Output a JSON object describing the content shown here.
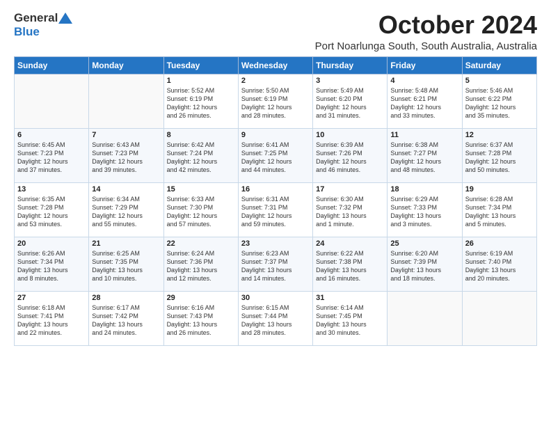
{
  "logo": {
    "general": "General",
    "blue": "Blue"
  },
  "title": "October 2024",
  "location": "Port Noarlunga South, South Australia, Australia",
  "days_of_week": [
    "Sunday",
    "Monday",
    "Tuesday",
    "Wednesday",
    "Thursday",
    "Friday",
    "Saturday"
  ],
  "weeks": [
    [
      {
        "day": "",
        "info": ""
      },
      {
        "day": "",
        "info": ""
      },
      {
        "day": "1",
        "info": "Sunrise: 5:52 AM\nSunset: 6:19 PM\nDaylight: 12 hours\nand 26 minutes."
      },
      {
        "day": "2",
        "info": "Sunrise: 5:50 AM\nSunset: 6:19 PM\nDaylight: 12 hours\nand 28 minutes."
      },
      {
        "day": "3",
        "info": "Sunrise: 5:49 AM\nSunset: 6:20 PM\nDaylight: 12 hours\nand 31 minutes."
      },
      {
        "day": "4",
        "info": "Sunrise: 5:48 AM\nSunset: 6:21 PM\nDaylight: 12 hours\nand 33 minutes."
      },
      {
        "day": "5",
        "info": "Sunrise: 5:46 AM\nSunset: 6:22 PM\nDaylight: 12 hours\nand 35 minutes."
      }
    ],
    [
      {
        "day": "6",
        "info": "Sunrise: 6:45 AM\nSunset: 7:23 PM\nDaylight: 12 hours\nand 37 minutes."
      },
      {
        "day": "7",
        "info": "Sunrise: 6:43 AM\nSunset: 7:23 PM\nDaylight: 12 hours\nand 39 minutes."
      },
      {
        "day": "8",
        "info": "Sunrise: 6:42 AM\nSunset: 7:24 PM\nDaylight: 12 hours\nand 42 minutes."
      },
      {
        "day": "9",
        "info": "Sunrise: 6:41 AM\nSunset: 7:25 PM\nDaylight: 12 hours\nand 44 minutes."
      },
      {
        "day": "10",
        "info": "Sunrise: 6:39 AM\nSunset: 7:26 PM\nDaylight: 12 hours\nand 46 minutes."
      },
      {
        "day": "11",
        "info": "Sunrise: 6:38 AM\nSunset: 7:27 PM\nDaylight: 12 hours\nand 48 minutes."
      },
      {
        "day": "12",
        "info": "Sunrise: 6:37 AM\nSunset: 7:28 PM\nDaylight: 12 hours\nand 50 minutes."
      }
    ],
    [
      {
        "day": "13",
        "info": "Sunrise: 6:35 AM\nSunset: 7:28 PM\nDaylight: 12 hours\nand 53 minutes."
      },
      {
        "day": "14",
        "info": "Sunrise: 6:34 AM\nSunset: 7:29 PM\nDaylight: 12 hours\nand 55 minutes."
      },
      {
        "day": "15",
        "info": "Sunrise: 6:33 AM\nSunset: 7:30 PM\nDaylight: 12 hours\nand 57 minutes."
      },
      {
        "day": "16",
        "info": "Sunrise: 6:31 AM\nSunset: 7:31 PM\nDaylight: 12 hours\nand 59 minutes."
      },
      {
        "day": "17",
        "info": "Sunrise: 6:30 AM\nSunset: 7:32 PM\nDaylight: 13 hours\nand 1 minute."
      },
      {
        "day": "18",
        "info": "Sunrise: 6:29 AM\nSunset: 7:33 PM\nDaylight: 13 hours\nand 3 minutes."
      },
      {
        "day": "19",
        "info": "Sunrise: 6:28 AM\nSunset: 7:34 PM\nDaylight: 13 hours\nand 5 minutes."
      }
    ],
    [
      {
        "day": "20",
        "info": "Sunrise: 6:26 AM\nSunset: 7:34 PM\nDaylight: 13 hours\nand 8 minutes."
      },
      {
        "day": "21",
        "info": "Sunrise: 6:25 AM\nSunset: 7:35 PM\nDaylight: 13 hours\nand 10 minutes."
      },
      {
        "day": "22",
        "info": "Sunrise: 6:24 AM\nSunset: 7:36 PM\nDaylight: 13 hours\nand 12 minutes."
      },
      {
        "day": "23",
        "info": "Sunrise: 6:23 AM\nSunset: 7:37 PM\nDaylight: 13 hours\nand 14 minutes."
      },
      {
        "day": "24",
        "info": "Sunrise: 6:22 AM\nSunset: 7:38 PM\nDaylight: 13 hours\nand 16 minutes."
      },
      {
        "day": "25",
        "info": "Sunrise: 6:20 AM\nSunset: 7:39 PM\nDaylight: 13 hours\nand 18 minutes."
      },
      {
        "day": "26",
        "info": "Sunrise: 6:19 AM\nSunset: 7:40 PM\nDaylight: 13 hours\nand 20 minutes."
      }
    ],
    [
      {
        "day": "27",
        "info": "Sunrise: 6:18 AM\nSunset: 7:41 PM\nDaylight: 13 hours\nand 22 minutes."
      },
      {
        "day": "28",
        "info": "Sunrise: 6:17 AM\nSunset: 7:42 PM\nDaylight: 13 hours\nand 24 minutes."
      },
      {
        "day": "29",
        "info": "Sunrise: 6:16 AM\nSunset: 7:43 PM\nDaylight: 13 hours\nand 26 minutes."
      },
      {
        "day": "30",
        "info": "Sunrise: 6:15 AM\nSunset: 7:44 PM\nDaylight: 13 hours\nand 28 minutes."
      },
      {
        "day": "31",
        "info": "Sunrise: 6:14 AM\nSunset: 7:45 PM\nDaylight: 13 hours\nand 30 minutes."
      },
      {
        "day": "",
        "info": ""
      },
      {
        "day": "",
        "info": ""
      }
    ]
  ]
}
